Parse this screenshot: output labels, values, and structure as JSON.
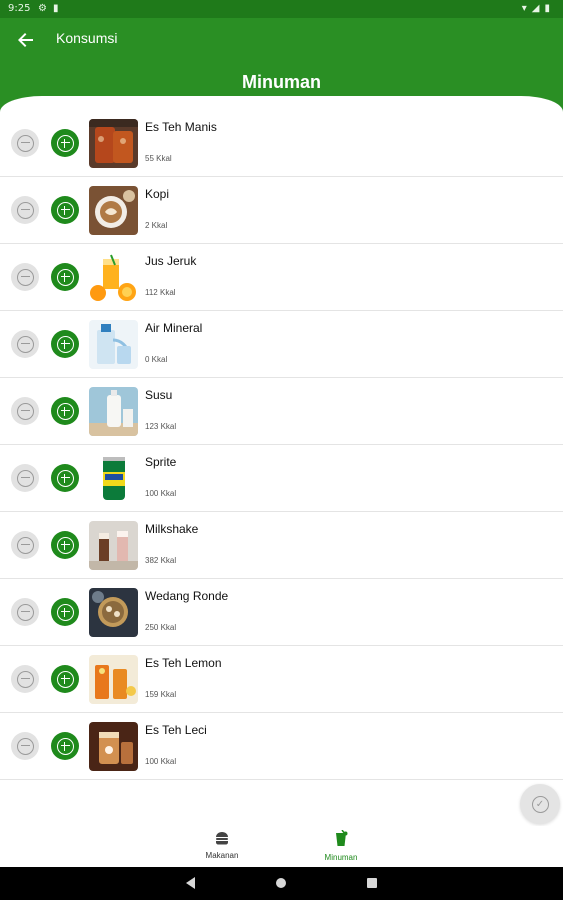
{
  "status_bar": {
    "time": "9:25",
    "left_icons": [
      "gear-icon",
      "sd-card-icon"
    ],
    "right_icons": [
      "wifi-icon",
      "signal-icon",
      "battery-icon"
    ]
  },
  "app_bar": {
    "title": "Konsumsi",
    "back_icon": "arrow-left-icon",
    "color": "#2a8f24"
  },
  "section": {
    "title": "Minuman"
  },
  "items": [
    {
      "name": "Es Teh Manis",
      "kcal": "55 Kkal",
      "image": "iced-sweet-tea"
    },
    {
      "name": "Kopi",
      "kcal": "2 Kkal",
      "image": "coffee"
    },
    {
      "name": "Jus Jeruk",
      "kcal": "112 Kkal",
      "image": "orange-juice"
    },
    {
      "name": "Air Mineral",
      "kcal": "0 Kkal",
      "image": "mineral-water"
    },
    {
      "name": "Susu",
      "kcal": "123 Kkal",
      "image": "milk"
    },
    {
      "name": "Sprite",
      "kcal": "100 Kkal",
      "image": "sprite-can"
    },
    {
      "name": "Milkshake",
      "kcal": "382 Kkal",
      "image": "milkshake"
    },
    {
      "name": "Wedang Ronde",
      "kcal": "250 Kkal",
      "image": "wedang-ronde"
    },
    {
      "name": "Es Teh Lemon",
      "kcal": "159 Kkal",
      "image": "lemon-tea"
    },
    {
      "name": "Es Teh Leci",
      "kcal": "100 Kkal",
      "image": "lychee-tea"
    }
  ],
  "fab": {
    "icon": "check-circle-icon"
  },
  "bottom_nav": {
    "items": [
      {
        "label": "Makanan",
        "icon": "burger-icon",
        "active": false
      },
      {
        "label": "Minuman",
        "icon": "drink-icon",
        "active": true
      }
    ],
    "active_color": "#1f8a1c"
  },
  "system_nav": [
    "back-triangle-icon",
    "home-circle-icon",
    "recents-square-icon"
  ]
}
